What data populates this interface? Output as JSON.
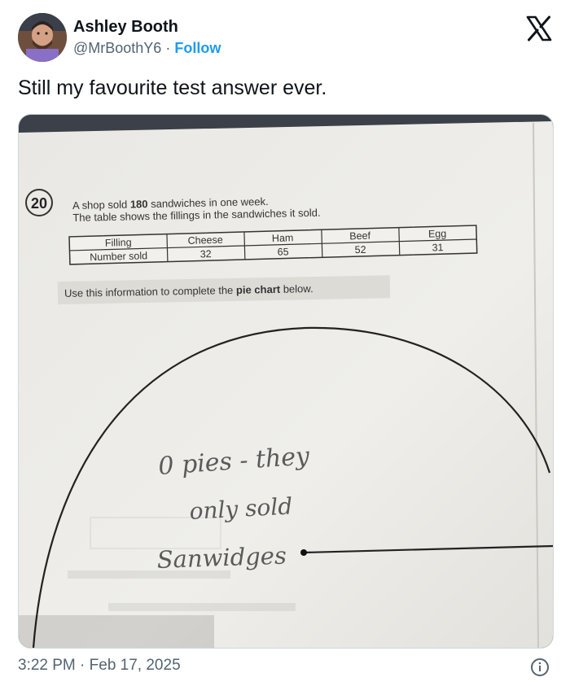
{
  "author": {
    "name": "Ashley Booth",
    "handle": "@MrBoothY6",
    "separator": "·",
    "follow_label": "Follow"
  },
  "tweet": {
    "text": "Still my favourite test answer ever.",
    "time": "3:22 PM",
    "separator": "·",
    "date": "Feb 17, 2025"
  },
  "icons": {
    "brand": "x-logo-icon",
    "info": "info-icon"
  },
  "photo": {
    "question_number": "20",
    "question_line1_pre": "A shop sold ",
    "question_line1_bold": "180",
    "question_line1_post": " sandwiches in one week.",
    "question_line2": "The table shows the fillings in the sandwiches it sold.",
    "table": {
      "row_headers": [
        "Filling",
        "Number sold"
      ],
      "columns": [
        {
          "filling": "Cheese",
          "sold": "32"
        },
        {
          "filling": "Ham",
          "sold": "65"
        },
        {
          "filling": "Beef",
          "sold": "52"
        },
        {
          "filling": "Egg",
          "sold": "31"
        }
      ]
    },
    "instruction_pre": "Use this information to complete the ",
    "instruction_bold": "pie chart",
    "instruction_post": " below.",
    "handwriting": {
      "line1": "0 pies - they",
      "line2": "only sold",
      "line3": "Sanwidges"
    }
  },
  "colors": {
    "follow": "#1d9bf0",
    "secondary_text": "#536471",
    "paper": "#ecebe7",
    "pencil": "#5a5a5a"
  }
}
